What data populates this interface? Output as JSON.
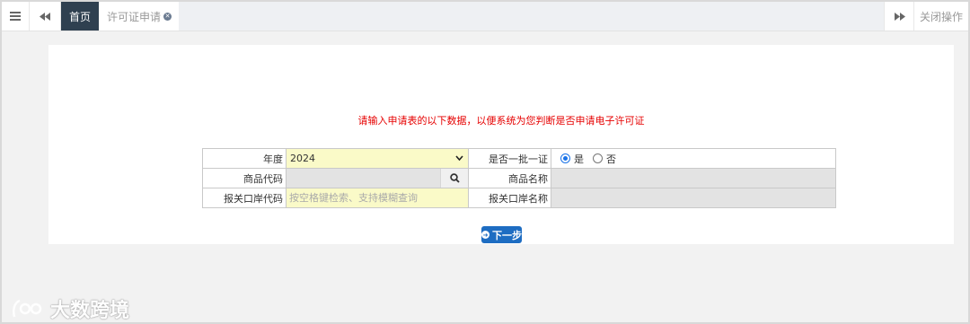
{
  "topbar": {
    "menu_icon": "hamburger-icon",
    "prev_icon": "double-left-icon",
    "next_icon": "double-right-icon",
    "tabs": [
      {
        "label": "首页",
        "active": true
      },
      {
        "label": "许可证申请",
        "active": false,
        "close_icon": "close-circle-icon"
      }
    ],
    "close_ops_label": "关闭操作"
  },
  "main": {
    "notice": "请输入申请表的以下数据，以便系统为您判断是否申请电子许可证",
    "form": {
      "year_label": "年度",
      "year_value": "2024",
      "batch_label": "是否一批一证",
      "batch_options": [
        {
          "label": "是",
          "checked": true
        },
        {
          "label": "否",
          "checked": false
        }
      ],
      "goods_code_label": "商品代码",
      "goods_code_value": "",
      "goods_name_label": "商品名称",
      "goods_name_value": "",
      "customs_code_label": "报关口岸代码",
      "customs_code_placeholder": "按空格键检索、支持模糊查询",
      "customs_name_label": "报关口岸名称",
      "customs_name_value": ""
    },
    "next_button_label": "下一步"
  },
  "watermark": "大数跨境",
  "colors": {
    "active_tab": "#2f4050",
    "notice_red": "#e60000",
    "primary_button": "#1e6dc2",
    "input_yellow": "#fafac8",
    "readonly_grey": "#e3e3e3"
  }
}
